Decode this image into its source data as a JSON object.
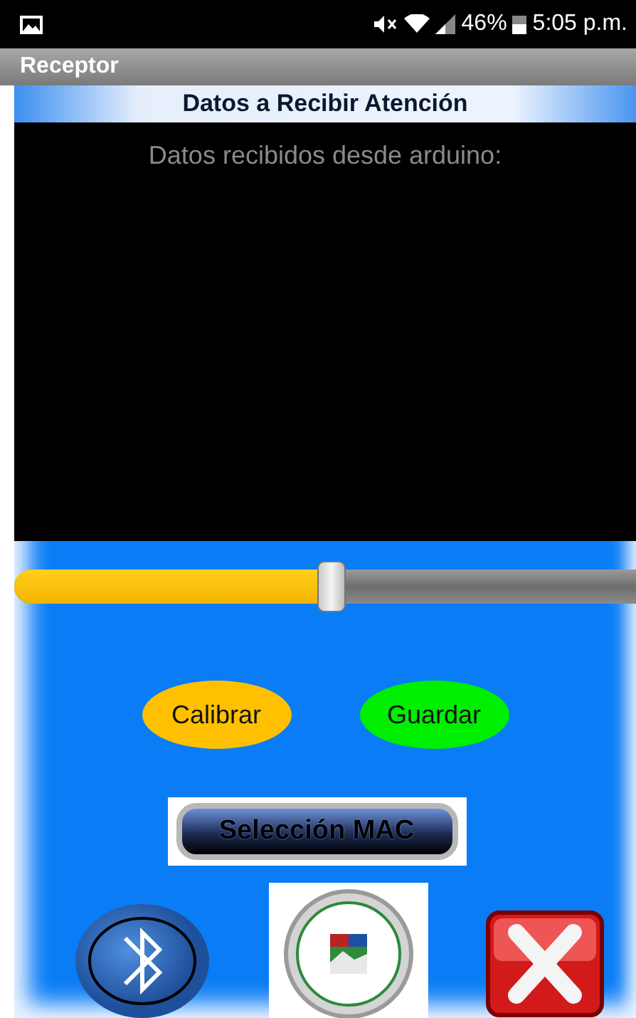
{
  "status_bar": {
    "battery": "46%",
    "time": "5:05 p.m."
  },
  "app_bar": {
    "title": "Receptor"
  },
  "header": "Datos a Recibir Atención",
  "received": {
    "text": "Datos recibidos desde arduino:"
  },
  "slider": {
    "level": 0.51
  },
  "buttons": [
    {
      "label": "Calibrar",
      "color": "#ffc000"
    },
    {
      "label": "Guardar",
      "color": "#00ee00"
    }
  ],
  "mac_button": {
    "label": "Selección MAC"
  }
}
